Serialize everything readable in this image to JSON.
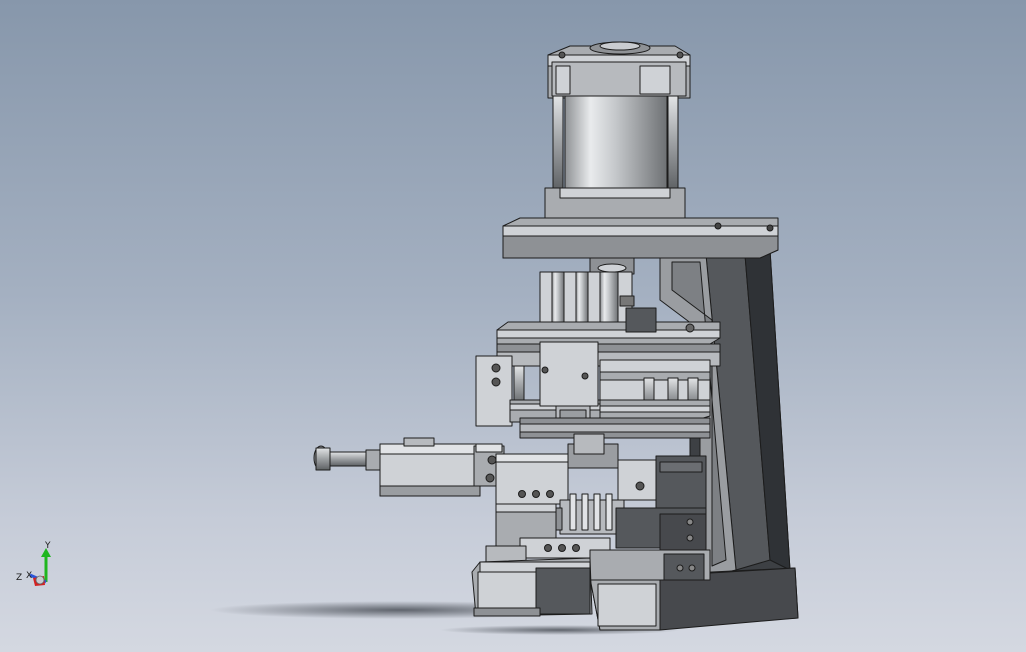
{
  "viewport": {
    "model": "cad-assembly"
  },
  "triad": {
    "y_label": "Y",
    "z_label": "Z",
    "x_label": "X",
    "colors": {
      "y_axis": "#1fb61f",
      "z_axis": "#2a55d8",
      "x_axis": "#d32222"
    }
  },
  "colors": {
    "background_top": "#8797ab",
    "background_bottom": "#d4d8e1",
    "part_light": "#cfd2d6",
    "part_mid": "#a9acb0",
    "part_dark": "#55585c",
    "frame_dark": "#3d4044",
    "edge": "#1c1c1c"
  }
}
